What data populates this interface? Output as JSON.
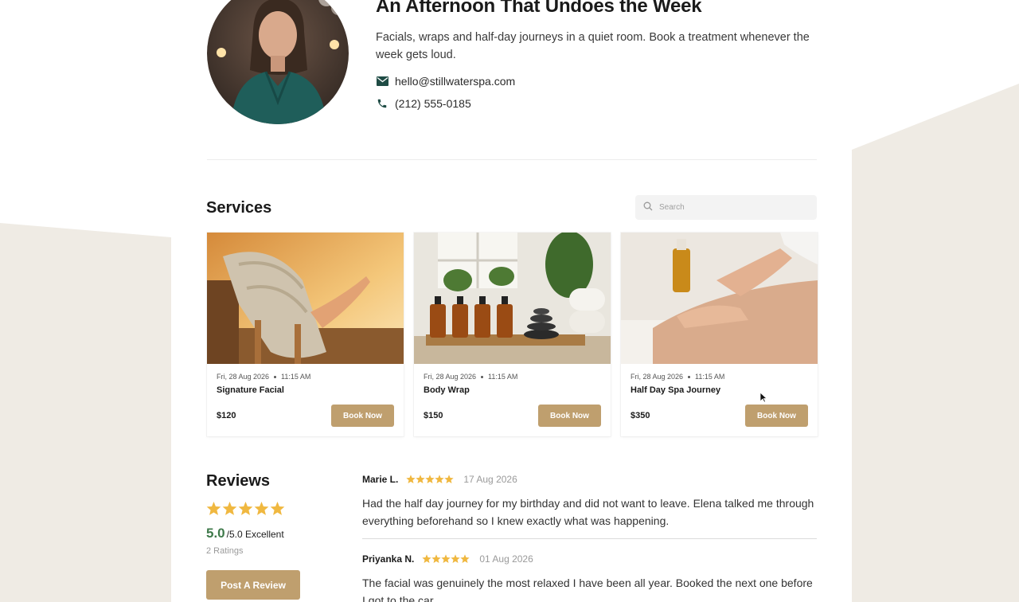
{
  "hero": {
    "title": "An Afternoon That Undoes the Week",
    "description": "Facials, wraps and half-day journeys in a quiet room. Book a treatment whenever the week gets loud.",
    "email": "hello@stillwaterspa.com",
    "phone": "(212) 555-0185"
  },
  "services": {
    "title": "Services",
    "search_placeholder": "Search",
    "items": [
      {
        "date": "Fri, 28 Aug 2026",
        "time": "11:15 AM",
        "name": "Signature Facial",
        "price": "$120",
        "button": "Book Now"
      },
      {
        "date": "Fri, 28 Aug 2026",
        "time": "11:15 AM",
        "name": "Body Wrap",
        "price": "$150",
        "button": "Book Now"
      },
      {
        "date": "Fri, 28 Aug 2026",
        "time": "11:15 AM",
        "name": "Half Day Spa Journey",
        "price": "$350",
        "button": "Book Now"
      }
    ]
  },
  "reviews": {
    "title": "Reviews",
    "score": "5.0",
    "score_suffix": "/5.0 Excellent",
    "rating_stars": 5,
    "ratings_count": "2 Ratings",
    "post_button": "Post A Review",
    "items": [
      {
        "author": "Marie L.",
        "stars": 5,
        "date": "17 Aug 2026",
        "text": "Had the half day journey for my birthday and did not want to leave. Elena talked me through everything beforehand so I knew exactly what was happening."
      },
      {
        "author": "Priyanka N.",
        "stars": 5,
        "date": "01 Aug 2026",
        "text": "The facial was genuinely the most relaxed I have been all year. Booked the next one before I got to the car."
      }
    ]
  },
  "colors": {
    "accent": "#bf9f6e",
    "star": "#f0b840",
    "score_green": "#3f7a4b",
    "background_shape": "#efebe4"
  }
}
